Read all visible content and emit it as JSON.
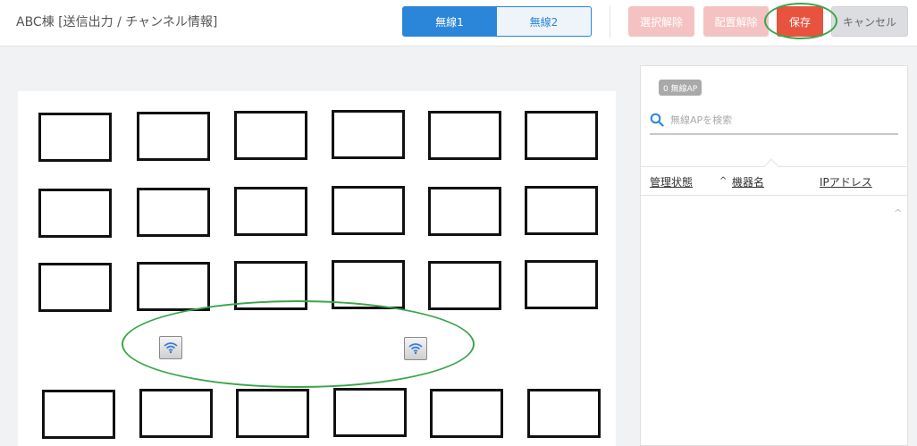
{
  "header": {
    "title": "ABC棟 [送信出力 / チャンネル情報]",
    "tabs": [
      "無線1",
      "無線2"
    ],
    "buttons": {
      "deselect": "選択解除",
      "unplace": "配置解除",
      "save": "保存",
      "cancel": "キャンセル"
    }
  },
  "panel": {
    "badge": "0 無線AP",
    "search_placeholder": "無線APを検索",
    "columns": [
      "管理状態",
      "機器名",
      "IPアドレス"
    ],
    "sort_indicator": "^"
  },
  "colors": {
    "primary": "#2b86d9",
    "save": "#e8533f",
    "disabled": "#f4c2c2",
    "annotation": "#3aa54a"
  }
}
